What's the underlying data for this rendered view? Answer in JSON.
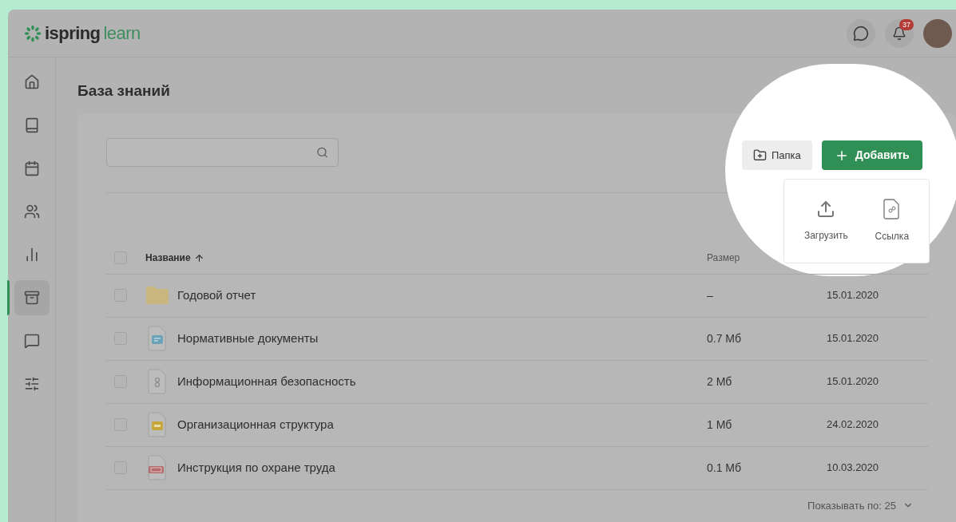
{
  "logo": {
    "brand": "ispring",
    "product": "learn"
  },
  "header": {
    "notification_count": "37"
  },
  "sidebar": {
    "items": [
      {
        "selected": false
      },
      {
        "selected": false
      },
      {
        "selected": false
      },
      {
        "selected": false
      },
      {
        "selected": false
      },
      {
        "selected": true
      },
      {
        "selected": false
      },
      {
        "selected": false
      }
    ]
  },
  "page_title": "База знаний",
  "toolbar": {
    "folder_button": "Папка",
    "add_button": "Добавить"
  },
  "add_menu": {
    "items": [
      {
        "kind": "upload",
        "label": "Загрузить"
      },
      {
        "kind": "link",
        "label": "Ссылка"
      }
    ]
  },
  "table": {
    "select_all_checked": false,
    "columns": [
      {
        "label": "Название",
        "sorted": true
      },
      {
        "label": "Размер",
        "sorted": false
      }
    ],
    "rows": [
      {
        "kind": "folder",
        "checked": false,
        "name": "Годовой отчет",
        "size": "–",
        "date": "15.01.2020"
      },
      {
        "kind": "document",
        "checked": false,
        "name": "Нормативные документы",
        "size": "0.7 Мб",
        "date": "15.01.2020"
      },
      {
        "kind": "archive",
        "checked": false,
        "name": "Информационная безопасность",
        "size": "2 Мб",
        "date": "15.01.2020"
      },
      {
        "kind": "presentation",
        "checked": false,
        "name": "Организационная структура",
        "size": "1 Мб",
        "date": "24.02.2020"
      },
      {
        "kind": "pdf",
        "checked": false,
        "name": "Инструкция по охране труда",
        "size": "0.1 Мб",
        "date": "10.03.2020"
      }
    ]
  },
  "pagination": {
    "label": "Показывать по: 25"
  }
}
